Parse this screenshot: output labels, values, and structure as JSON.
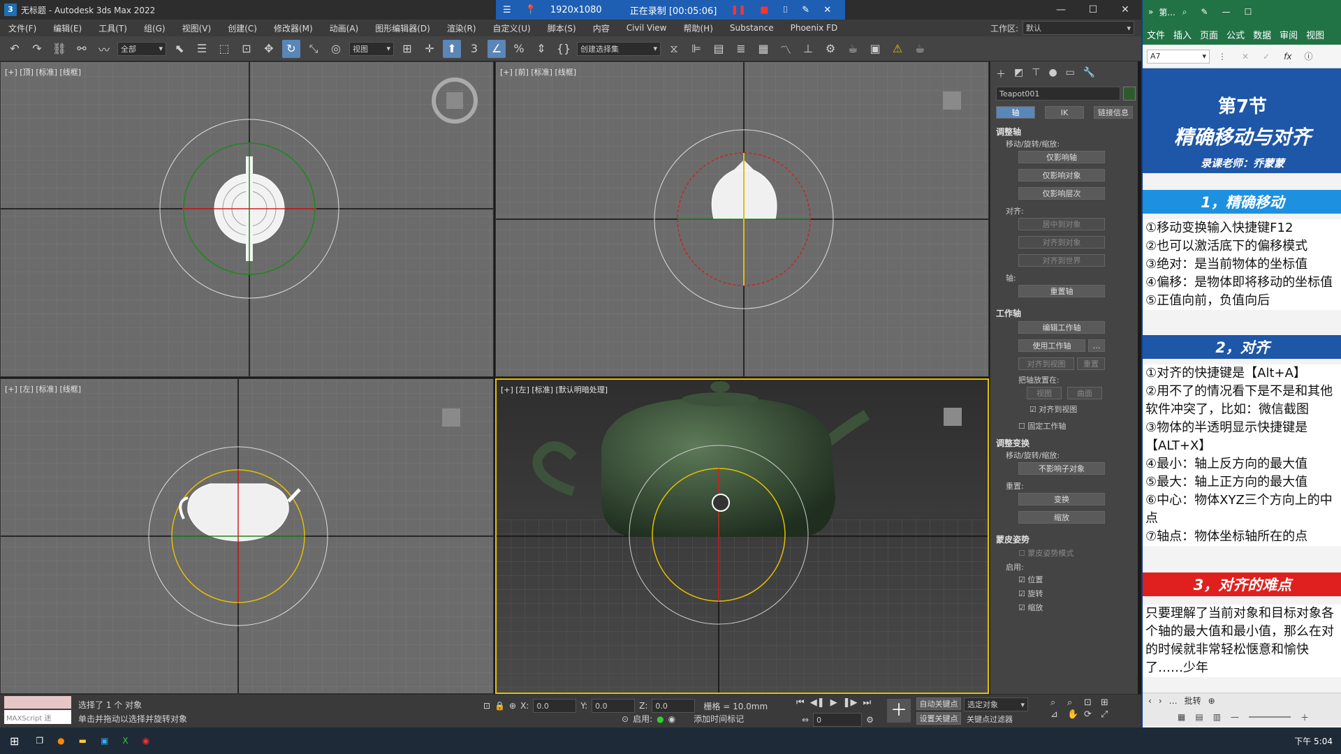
{
  "titlebar": {
    "icon": "3",
    "title": "无标题 - Autodesk 3ds Max 2022"
  },
  "recorder": {
    "resolution": "1920x1080",
    "status": "正在录制 [00:05:06]"
  },
  "menu": [
    "文件(F)",
    "编辑(E)",
    "工具(T)",
    "组(G)",
    "视图(V)",
    "创建(C)",
    "修改器(M)",
    "动画(A)",
    "图形编辑器(D)",
    "渲染(R)",
    "自定义(U)",
    "脚本(S)",
    "内容",
    "Civil View",
    "帮助(H)",
    "Substance",
    "Phoenix FD"
  ],
  "workspace": {
    "label": "工作区:",
    "value": "默认"
  },
  "toolbar": {
    "filter": "全部",
    "ref_coord": "视图",
    "selection_set": "创建选择集"
  },
  "viewports": {
    "top": "[+] [顶] [标准] [线框]",
    "front": "[+] [前] [标准] [线框]",
    "left": "[+] [左] [标准] [线框]",
    "persp": "[+] [左] [标准] [默认明暗处理]"
  },
  "cmd": {
    "object_name": "Teapot001",
    "tabs": [
      "轴",
      "IK",
      "链接信息"
    ],
    "s1": "调整轴",
    "move_rotate_scale": "移动/旋转/缩放:",
    "btn_pivot_only": "仅影响轴",
    "btn_object_only": "仅影响对象",
    "btn_hierarchy_only": "仅影响层次",
    "align_label": "对齐:",
    "btn_center": "居中到对象",
    "btn_align_obj": "对齐到对象",
    "btn_align_world": "对齐到世界",
    "pivot_label": "轴:",
    "btn_reset_pivot": "重置轴",
    "s2": "工作轴",
    "btn_edit_wp": "编辑工作轴",
    "btn_use_wp": "使用工作轴",
    "btn_align_view": "对齐到视图",
    "btn_reset": "重置",
    "place_pivot": "把轴放置在:",
    "btn_view": "视图",
    "btn_surface": "曲面",
    "chk_align_view": "对齐到视图",
    "chk_fixed_wp": "固定工作轴",
    "s3": "调整变换",
    "move_rotate_scale2": "移动/旋转/缩放:",
    "btn_dont_affect": "不影响子对象",
    "reset_label": "重置:",
    "btn_transform": "变换",
    "btn_scale": "缩放",
    "s4": "蒙皮姿势",
    "skin_mode": "蒙皮姿势模式",
    "enable": "启用:",
    "chk_pos": "位置",
    "chk_rot": "旋转",
    "chk_scale": "缩放"
  },
  "status": {
    "maxscript": "MAXScript 迷",
    "selected": "选择了 1 个 对象",
    "hint": "单击并拖动以选择并旋转对象",
    "x": "0.0",
    "y": "0.0",
    "z": "0.0",
    "grid": "栅格 = 10.0mm",
    "auto_key": "自动关键点",
    "selected_obj": "选定对象",
    "set_key": "设置关键点",
    "key_filter": "关键点过滤器",
    "enable": "启用:",
    "add_tag": "添加时间标记",
    "frame": "0"
  },
  "taskbar": {
    "time": "下午 5:04"
  },
  "excel": {
    "title": "第...",
    "tabs": [
      "文件",
      "插入",
      "页面",
      "公式",
      "数据",
      "审阅",
      "视图"
    ],
    "cell": "A7",
    "header_line1": "第7节",
    "header_line2": "精确移动与对齐",
    "header_line3": "录课老师：乔蒙蒙",
    "sec1": "1，精确移动",
    "sec1_lines": [
      "①移动变换输入快捷键F12",
      "②也可以激活底下的偏移模式",
      "③绝对：是当前物体的坐标值",
      "④偏移：是物体即将移动的坐标值",
      "⑤正值向前，负值向后"
    ],
    "sec2": "2，对齐",
    "sec2_lines": [
      "①对齐的快捷键是【Alt+A】",
      "②用不了的情况看下是不是和其他软件冲突了，比如：微信截图",
      "③物体的半透明显示快捷键是【ALT+X】",
      "④最小：轴上反方向的最大值",
      "⑤最大：轴上正方向的最大值",
      "⑥中心：物体XYZ三个方向上的中点",
      "⑦轴点：物体坐标轴所在的点"
    ],
    "sec3": "3，对齐的难点",
    "sec3_text": "只要理解了当前对象和目标对象各个轴的最大值和最小值，那么在对的时候就非常轻松惬意和愉快了……少年",
    "sheet": "批转"
  }
}
